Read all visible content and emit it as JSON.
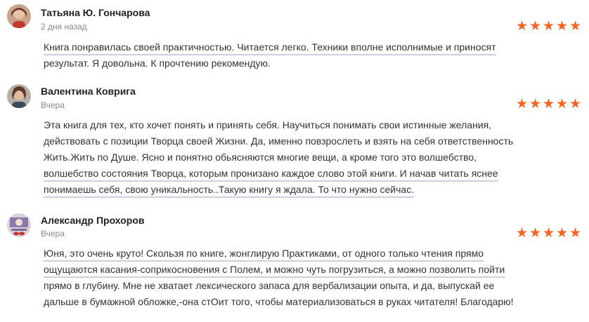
{
  "reviews": [
    {
      "author": "Татьяна Ю. Гончарова",
      "date": "2 дня назад",
      "rating": 5,
      "stars": "★★★★★",
      "lines": [
        "Книга понравилась своей практичностью. Читается легко. Техники вполне исполнимые и приносят",
        "результат. Я довольна. К прочтению рекомендую."
      ]
    },
    {
      "author": "Валентина Коврига",
      "date": "Вчера",
      "rating": 5,
      "stars": "★★★★★",
      "lines": [
        "Эта книга для тех, кто хочет понять и принять себя. Научиться понимать свои истинные желания,",
        "действовать с позиции Творца своей Жизни. Да, именно повзрослеть и взять на себя ответственность",
        "Жить.Жить по Душе. Ясно и понятно обьясняются многие вещи, а кроме того это волшебство,",
        "волшебство состояния Творца, которым пронизано каждое слово этой книги. И начав читать яснее",
        "понимаешь себя, свою уникальность..Такую книгу я ждала. То что нужно сейчас."
      ]
    },
    {
      "author": "Александр Прохоров",
      "date": "Вчера",
      "rating": 5,
      "stars": "★★★★★",
      "lines": [
        "Юня, это очень круто! Скользя по книге, жонглирую Практиками, от одного только чтения прямо",
        "ощущаются касания-соприкосновения с Полем, и можно чуть погрузиться, а можно позволить пойти",
        "прямо в глубину. Мне не хватает лексического запаса для вербализации опыта, и да, выпускай ее",
        "дальше в бумажной обложке,-она стОит того, чтобы материализоваться в руках читателя! Благодарю!"
      ]
    }
  ],
  "colors": {
    "star": "#f26522",
    "highlight_underline": "#d6c9e2",
    "author": "#222222",
    "date": "#8a8a8a",
    "text": "#333333"
  },
  "icons": [
    "user-avatar-photo",
    "star-icon"
  ]
}
